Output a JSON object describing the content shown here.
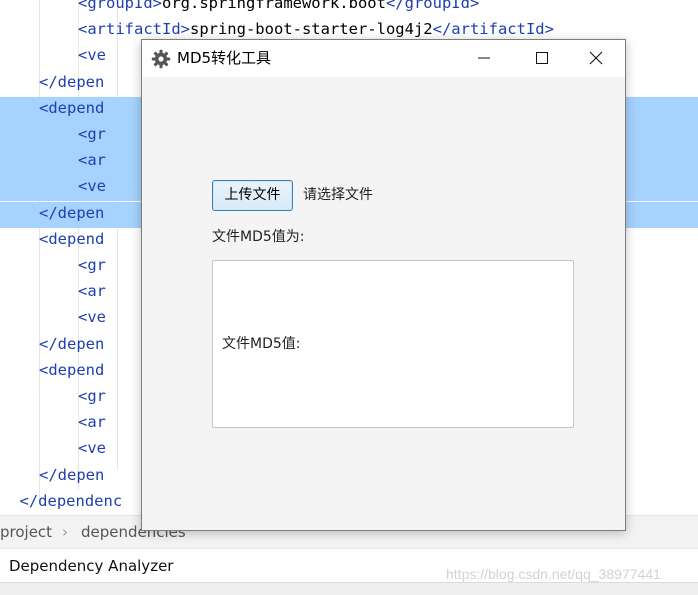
{
  "editor": {
    "lines": [
      {
        "indent": 4,
        "parts": [
          [
            "t",
            "<groupId>"
          ],
          [
            "v",
            "org.springframework.boot"
          ],
          [
            "t",
            "</groupId>"
          ]
        ]
      },
      {
        "indent": 4,
        "parts": [
          [
            "t",
            "<artifactId>"
          ],
          [
            "v",
            "spring-boot-starter-log4j2"
          ],
          [
            "t",
            "</artifactId>"
          ]
        ]
      },
      {
        "indent": 4,
        "parts": [
          [
            "t",
            "<ve"
          ]
        ]
      },
      {
        "indent": 2,
        "parts": [
          [
            "t",
            "</depen"
          ]
        ]
      },
      {
        "indent": 2,
        "parts": [
          [
            "t",
            "<depend"
          ]
        ],
        "selected": true
      },
      {
        "indent": 4,
        "parts": [
          [
            "t",
            "<gr"
          ]
        ],
        "selected": true
      },
      {
        "indent": 4,
        "parts": [
          [
            "t",
            "<ar"
          ]
        ],
        "selected": true
      },
      {
        "indent": 4,
        "parts": [
          [
            "t",
            "<ve"
          ]
        ],
        "selected": true
      },
      {
        "indent": 2,
        "parts": [
          [
            "t",
            "</depen"
          ]
        ],
        "selected": true
      },
      {
        "indent": 2,
        "parts": [
          [
            "t",
            "<depend"
          ]
        ]
      },
      {
        "indent": 4,
        "parts": [
          [
            "t",
            "<gr"
          ]
        ]
      },
      {
        "indent": 4,
        "parts": [
          [
            "t",
            "<ar"
          ]
        ]
      },
      {
        "indent": 4,
        "parts": [
          [
            "t",
            "<ve"
          ]
        ]
      },
      {
        "indent": 2,
        "parts": [
          [
            "t",
            "</depen"
          ]
        ]
      },
      {
        "indent": 2,
        "parts": [
          [
            "t",
            "<depend"
          ]
        ]
      },
      {
        "indent": 4,
        "parts": [
          [
            "t",
            "<gr"
          ]
        ]
      },
      {
        "indent": 4,
        "parts": [
          [
            "t",
            "<ar"
          ]
        ]
      },
      {
        "indent": 4,
        "parts": [
          [
            "t",
            "<ve"
          ]
        ]
      },
      {
        "indent": 2,
        "parts": [
          [
            "t",
            "</depen"
          ]
        ]
      },
      {
        "indent": 1,
        "parts": [
          [
            "t",
            "</dependenc"
          ]
        ]
      }
    ]
  },
  "breadcrumb": {
    "items": [
      "project",
      "dependencies"
    ],
    "separator": "›"
  },
  "tool_window": {
    "tab_label": "Dependency Analyzer"
  },
  "watermark": "https://blog.csdn.net/qq_38977441",
  "dialog": {
    "title": "MD5转化工具",
    "icon": "gear-icon",
    "upload_button": "上传文件",
    "file_status": "请选择文件",
    "md5_label": "文件MD5值为:",
    "md5_value": "文件MD5值:"
  },
  "colors": {
    "tag": "#1f3fb0",
    "selection": "#a6d2ff",
    "button_border": "#3c7fb1"
  }
}
